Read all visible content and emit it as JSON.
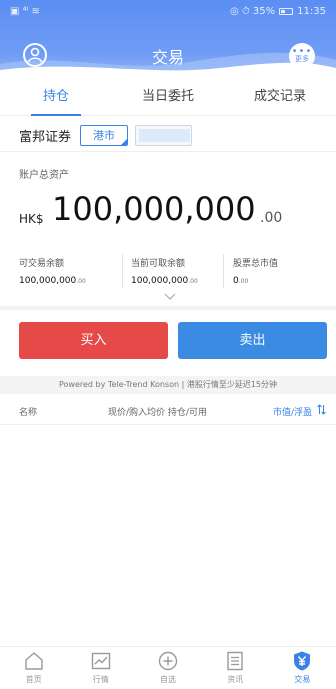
{
  "status_bar": {
    "left_text": "▣ ⁴ˡ ≋",
    "right_text": "◎ ⏱ 35%",
    "time": "11:35"
  },
  "header": {
    "title": "交易",
    "more_label": "更多"
  },
  "tabs": [
    {
      "label": "持仓",
      "active": true
    },
    {
      "label": "当日委托",
      "active": false
    },
    {
      "label": "成交记录",
      "active": false
    }
  ],
  "broker": {
    "name": "富邦证券",
    "market": "港市"
  },
  "assets": {
    "label": "账户总资产",
    "currency": "HK$",
    "amount": "100,000,000",
    "decimal": ".00"
  },
  "balances": [
    {
      "label": "可交易余额",
      "value": "100,000,000",
      "decimal": ".00"
    },
    {
      "label": "当前可取余额",
      "value": "100,000,000",
      "decimal": ".00"
    },
    {
      "label": "股票总市值",
      "value": "0",
      "decimal": ".00"
    }
  ],
  "actions": {
    "buy": "买入",
    "sell": "卖出"
  },
  "powered_text": "Powered by Tele-Trend Konson | 港股行情至少延迟15分钟",
  "holdings_header": {
    "name": "名称",
    "price": "现价/购入均价",
    "position": "持仓/可用",
    "market_value": "市值/浮盈"
  },
  "bottom_nav": [
    {
      "label": "首页",
      "icon": "home-icon",
      "active": false
    },
    {
      "label": "行情",
      "icon": "chart-icon",
      "active": false
    },
    {
      "label": "自选",
      "icon": "plus-circle-icon",
      "active": false
    },
    {
      "label": "资讯",
      "icon": "document-icon",
      "active": false
    },
    {
      "label": "交易",
      "icon": "yen-shield-icon",
      "active": true
    }
  ],
  "colors": {
    "primary": "#3b82e6",
    "header": "#5b8ef3",
    "buy": "#e64a48",
    "sell": "#3b8be3"
  }
}
